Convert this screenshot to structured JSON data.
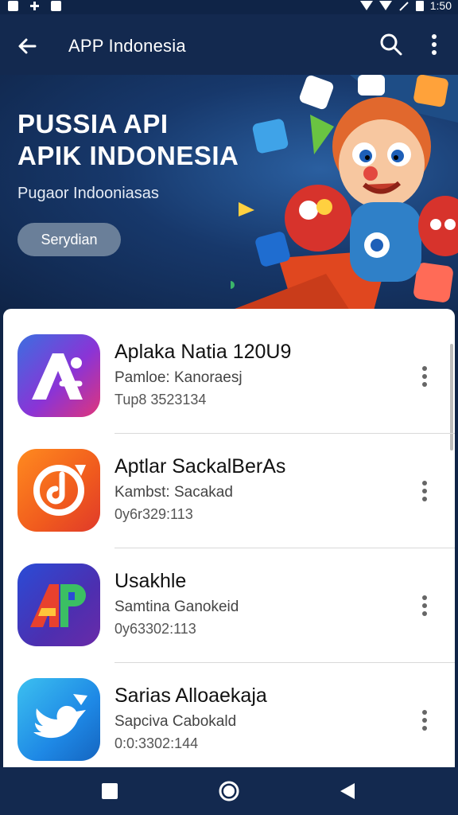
{
  "status_bar": {
    "time": "1:50",
    "icons": [
      "notification-icon",
      "plus-icon",
      "download-icon",
      "wifi-icon",
      "signal-icon",
      "data-icon",
      "battery-icon"
    ]
  },
  "app_bar": {
    "title": "APP Indonesia",
    "back_icon": "back-arrow-icon",
    "search_icon": "search-icon",
    "more_icon": "more-vert-icon"
  },
  "banner": {
    "title_line1": "PUSSIA API",
    "title_line2": "APIK INDONESIA",
    "subtitle": "Pugaor Indooniasas",
    "button_label": "Serydian"
  },
  "apps": [
    {
      "name": "Aplaka Natia 120U9",
      "line1": "Pamloe: Kanoraesj",
      "line2": "Tup8 3523134",
      "icon": "letter-a-app-icon"
    },
    {
      "name": "Aptlar SackalBerAs",
      "line1": "Kambst: Sacakad",
      "line2": "0y6r329:113",
      "icon": "sync-app-icon"
    },
    {
      "name": "Usakhle",
      "line1": "Samtina Ganokeid",
      "line2": "0y63302:113",
      "icon": "ap-logo-app-icon"
    },
    {
      "name": "Sarias Alloaekaja",
      "line1": "Sapciva Cabokald",
      "line2": "0:0:3302:144",
      "icon": "bird-app-icon"
    }
  ],
  "colors": {
    "primary": "#13294f",
    "banner_button": "#6a7f99",
    "card": "#ffffff"
  },
  "nav": {
    "items": [
      "recents-icon",
      "home-icon",
      "back-icon"
    ]
  }
}
